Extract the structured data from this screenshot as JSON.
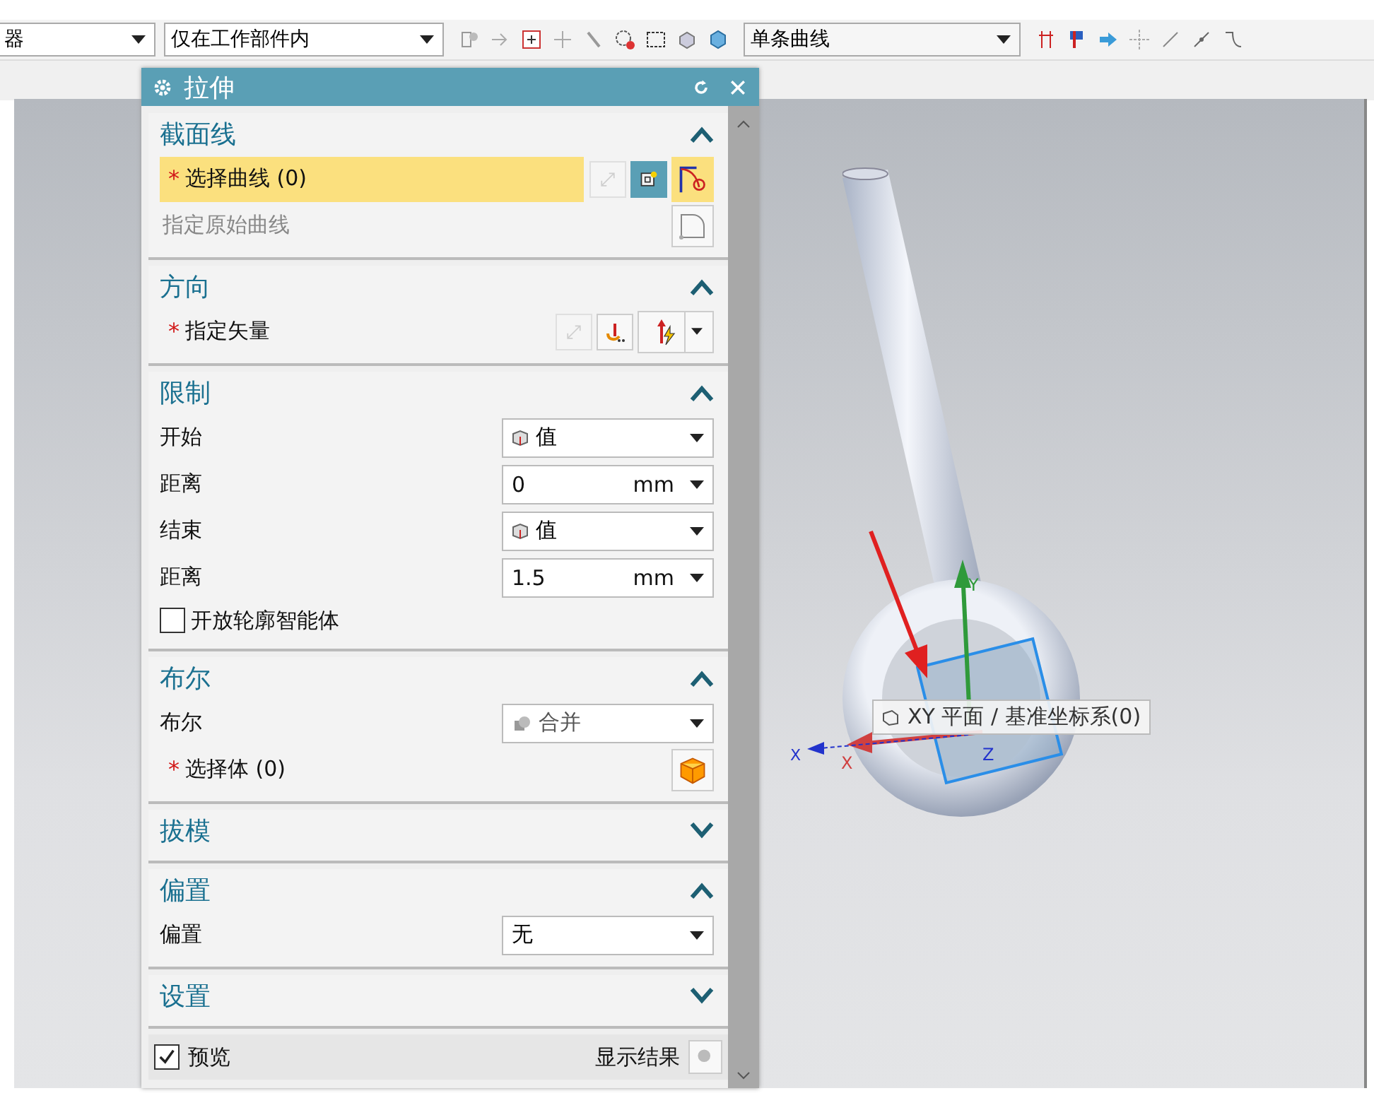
{
  "toolbar": {
    "filters": [
      {
        "value": "器"
      },
      {
        "value": "仅在工作部件内"
      },
      {
        "value": "单条曲线"
      }
    ]
  },
  "dialog": {
    "title": "拉伸",
    "sections": [
      {
        "title": "截面线",
        "expanded": true,
        "rows": [
          {
            "kind": "select",
            "marker": "*",
            "label": "选择曲线 (0)",
            "highlighted": true,
            "disabled": false,
            "buttons": [
              {
                "kind": "reverse",
                "disabled": true
              },
              {
                "kind": "sketch",
                "disabled": false
              },
              {
                "kind": "curve",
                "disabled": false
              }
            ]
          },
          {
            "kind": "select",
            "label": "指定原始曲线",
            "highlighted": false,
            "disabled": true,
            "buttons": [
              {
                "kind": "original",
                "disabled": false
              }
            ]
          }
        ]
      },
      {
        "title": "方向",
        "expanded": true,
        "rows": [
          {
            "kind": "select",
            "marker": "*",
            "label": "指定矢量",
            "highlighted": false,
            "disabled": false,
            "buttons": [
              {
                "kind": "reverse",
                "disabled": true
              },
              {
                "kind": "vector-dialog",
                "disabled": false
              },
              {
                "kind": "vector",
                "disabled": false
              }
            ]
          }
        ]
      },
      {
        "title": "限制",
        "expanded": true,
        "rows": [
          {
            "kind": "type-dropdown",
            "label": "开始",
            "value": "值"
          },
          {
            "kind": "number",
            "label": "距离",
            "value": "0",
            "unit": "mm"
          },
          {
            "kind": "type-dropdown",
            "label": "结束",
            "value": "值"
          },
          {
            "kind": "number",
            "label": "距离",
            "value": "1.5",
            "unit": "mm"
          },
          {
            "kind": "checkbox",
            "label": "开放轮廓智能体",
            "checked": false
          }
        ]
      },
      {
        "title": "布尔",
        "expanded": true,
        "rows": [
          {
            "kind": "boolean-dropdown",
            "label": "布尔",
            "value": "合并"
          },
          {
            "kind": "select",
            "marker": "*",
            "label": "选择体 (0)",
            "highlighted": false,
            "disabled": false,
            "buttons": [
              {
                "kind": "body",
                "disabled": false
              }
            ]
          }
        ]
      },
      {
        "title": "拔模",
        "expanded": false
      },
      {
        "title": "偏置",
        "expanded": true,
        "rows": [
          {
            "kind": "dropdown",
            "label": "偏置",
            "value": "无"
          }
        ]
      },
      {
        "title": "设置",
        "expanded": false
      }
    ],
    "footer": {
      "preview": {
        "label": "预览",
        "checked": true
      },
      "show_result": "显示结果"
    }
  },
  "viewport": {
    "tooltip": "XY 平面 / 基准坐标系(0)",
    "axis_labels": [
      "Y",
      "X",
      "X",
      "Z"
    ]
  }
}
